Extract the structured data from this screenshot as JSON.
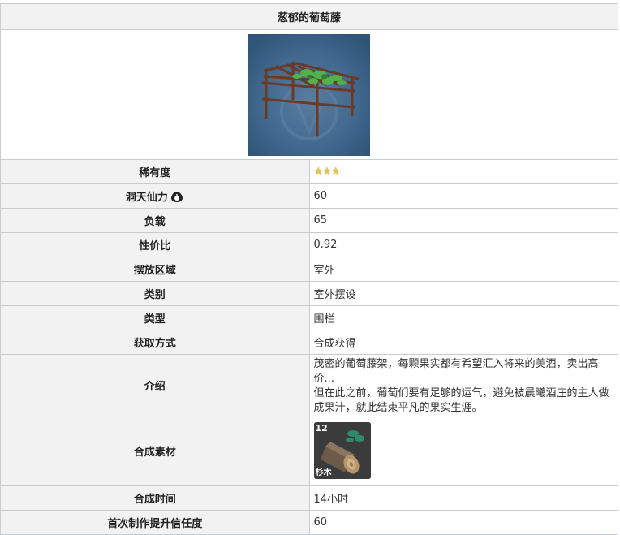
{
  "title": "葱郁的葡萄藤",
  "rows": {
    "rarity": {
      "label": "稀有度",
      "stars": 3
    },
    "adeptal_energy": {
      "label": "洞天仙力",
      "value": "60"
    },
    "load": {
      "label": "负载",
      "value": "65"
    },
    "cost_ratio": {
      "label": "性价比",
      "value": "0.92"
    },
    "placement": {
      "label": "摆放区域",
      "value": "室外"
    },
    "category": {
      "label": "类别",
      "value": "室外摆设"
    },
    "type": {
      "label": "类型",
      "value": "围栏"
    },
    "source": {
      "label": "获取方式",
      "value": "合成获得"
    },
    "intro": {
      "label": "介绍",
      "line1": "茂密的葡萄藤架，每颗果实都有希望汇入将来的美酒，卖出高价...",
      "line2": "但在此之前，葡萄们要有足够的运气，避免被晨曦酒庄的主人做成果汁，就此结束平凡的果实生涯。"
    },
    "materials": {
      "label": "合成素材",
      "count": "12",
      "name": "杉木"
    },
    "craft_time": {
      "label": "合成时间",
      "value": "14小时"
    },
    "trust": {
      "label": "首次制作提升信任度",
      "value": "60"
    }
  },
  "colors": {
    "header_bg": "#f2f2f2",
    "border": "#c8ccd1",
    "star": "#e8c34a",
    "image_bg": "#3d7a9a"
  },
  "icons": {
    "adeptal": "adeptal-energy-icon",
    "star": "star-icon"
  }
}
